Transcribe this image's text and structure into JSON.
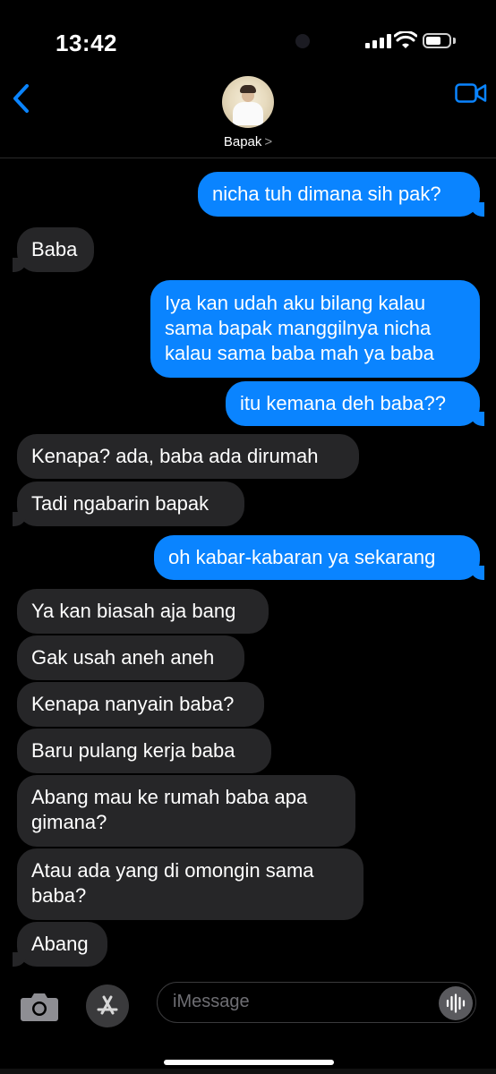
{
  "status_bar": {
    "time": "13:42"
  },
  "header": {
    "contact_name": "Bapak",
    "name_chevron": ">"
  },
  "messages": [
    {
      "dir": "out",
      "text": "nicha tuh dimana sih pak?"
    },
    {
      "dir": "in",
      "text": "Baba"
    },
    {
      "dir": "out",
      "text": "Iya kan udah aku bilang kalau"
    },
    {
      "dir": "out",
      "text": "sama bapak manggilnya nicha"
    },
    {
      "dir": "out",
      "text": "kalau sama baba mah ya baba"
    },
    {
      "dir": "out",
      "text": "itu kemana deh baba??"
    },
    {
      "dir": "in",
      "text": "Kenapa? ada, baba ada dirumah"
    },
    {
      "dir": "in",
      "text": "Tadi ngabarin bapak"
    },
    {
      "dir": "out",
      "text": "oh kabar-kabaran ya sekarang"
    },
    {
      "dir": "in",
      "text": "Ya kan biasah aja bang"
    },
    {
      "dir": "in",
      "text": "Gak usah aneh aneh"
    },
    {
      "dir": "in",
      "text": "Kenapa nanyain baba?"
    },
    {
      "dir": "in",
      "text": "Baru pulang kerja baba"
    },
    {
      "dir": "in",
      "text": "Abang mau ke rumah baba apa"
    },
    {
      "dir": "in",
      "text": "gimana?"
    },
    {
      "dir": "in",
      "text": "Atau ada yang di omongin sama"
    },
    {
      "dir": "in",
      "text": "baba?"
    },
    {
      "dir": "in",
      "text": "Abang"
    }
  ],
  "composer": {
    "placeholder": "iMessage"
  },
  "colors": {
    "outgoing_bubble": "#0a84ff",
    "incoming_bubble": "#262628",
    "accent": "#0a84ff",
    "background": "#000000"
  },
  "icons": [
    "back-chevron-icon",
    "video-call-icon",
    "camera-icon",
    "app-store-icon",
    "audio-waveform-icon"
  ]
}
